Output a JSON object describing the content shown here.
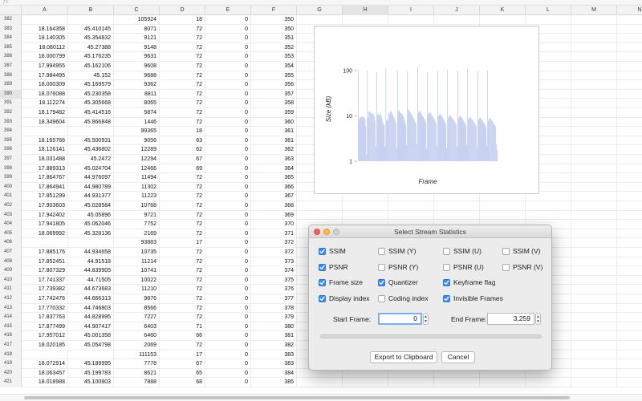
{
  "formula_bar": {
    "fx": "fx"
  },
  "columns": [
    "A",
    "B",
    "C",
    "D",
    "E",
    "F",
    "G",
    "H",
    "I",
    "J",
    "K",
    "L",
    "M",
    "N"
  ],
  "active_column": "H",
  "active_row": "390",
  "rows": [
    [
      "382",
      "",
      "",
      "105924",
      "18",
      "0",
      "350"
    ],
    [
      "383",
      "18.164358",
      "45.410145",
      "8071",
      "72",
      "0",
      "350"
    ],
    [
      "384",
      "18.140305",
      "45.354832",
      "9121",
      "72",
      "0",
      "351"
    ],
    [
      "385",
      "18.080112",
      "45.27388",
      "9148",
      "72",
      "0",
      "352"
    ],
    [
      "386",
      "18.000799",
      "45.176235",
      "9631",
      "72",
      "0",
      "353"
    ],
    [
      "387",
      "17.994955",
      "45.162106",
      "9608",
      "72",
      "0",
      "354"
    ],
    [
      "388",
      "17.984495",
      "45.152",
      "9688",
      "72",
      "0",
      "355"
    ],
    [
      "389",
      "18.000309",
      "45.169579",
      "9362",
      "72",
      "0",
      "356"
    ],
    [
      "390",
      "18.076088",
      "45.230358",
      "8811",
      "72",
      "0",
      "357"
    ],
    [
      "391",
      "18.112274",
      "45.305668",
      "8065",
      "72",
      "0",
      "358"
    ],
    [
      "392",
      "18.179482",
      "45.414516",
      "5874",
      "72",
      "0",
      "359"
    ],
    [
      "393",
      "18.349604",
      "45.866848",
      "1446",
      "72",
      "0",
      "360"
    ],
    [
      "394",
      "",
      "",
      "99365",
      "18",
      "0",
      "361"
    ],
    [
      "395",
      "18.165766",
      "45.500931",
      "9056",
      "63",
      "0",
      "361"
    ],
    [
      "396",
      "18.126141",
      "45.436802",
      "12289",
      "62",
      "0",
      "362"
    ],
    [
      "397",
      "18.031488",
      "45.2472",
      "12294",
      "67",
      "0",
      "363"
    ],
    [
      "398",
      "17.889313",
      "45.024704",
      "12466",
      "69",
      "0",
      "364"
    ],
    [
      "399",
      "17.864767",
      "44.976097",
      "11494",
      "72",
      "0",
      "365"
    ],
    [
      "400",
      "17.864941",
      "44.980789",
      "11302",
      "72",
      "0",
      "366"
    ],
    [
      "401",
      "17.851299",
      "44.931377",
      "11223",
      "72",
      "0",
      "367"
    ],
    [
      "402",
      "17.903603",
      "45.028584",
      "10768",
      "72",
      "0",
      "368"
    ],
    [
      "403",
      "17.942402",
      "45.05896",
      "9721",
      "72",
      "0",
      "369"
    ],
    [
      "404",
      "17.941805",
      "45.062046",
      "7752",
      "72",
      "0",
      "370"
    ],
    [
      "405",
      "18.069992",
      "45.328136",
      "2169",
      "72",
      "0",
      "371"
    ],
    [
      "406",
      "",
      "",
      "93883",
      "17",
      "0",
      "372"
    ],
    [
      "407",
      "17.885176",
      "44.934658",
      "10735",
      "72",
      "0",
      "372"
    ],
    [
      "408",
      "17.852451",
      "44.91518",
      "11214",
      "72",
      "0",
      "373"
    ],
    [
      "409",
      "17.807329",
      "44.839905",
      "10741",
      "72",
      "0",
      "374"
    ],
    [
      "410",
      "17.741337",
      "44.71505",
      "10022",
      "72",
      "0",
      "375"
    ],
    [
      "411",
      "17.739382",
      "44.673683",
      "11210",
      "72",
      "0",
      "376"
    ],
    [
      "412",
      "17.742476",
      "44.666313",
      "9876",
      "72",
      "0",
      "377"
    ],
    [
      "413",
      "17.770332",
      "44.746803",
      "8566",
      "72",
      "0",
      "378"
    ],
    [
      "414",
      "17.837763",
      "44.828995",
      "7227",
      "72",
      "0",
      "379"
    ],
    [
      "415",
      "17.877499",
      "44.907417",
      "6403",
      "71",
      "0",
      "380"
    ],
    [
      "416",
      "17.957012",
      "45.001358",
      "6460",
      "66",
      "0",
      "381"
    ],
    [
      "417",
      "18.020185",
      "45.054798",
      "2069",
      "72",
      "0",
      "382"
    ],
    [
      "418",
      "",
      "",
      "111153",
      "17",
      "0",
      "383"
    ],
    [
      "419",
      "18.072914",
      "45.189995",
      "7778",
      "67",
      "0",
      "383"
    ],
    [
      "420",
      "18.063457",
      "45.199783",
      "8621",
      "65",
      "0",
      "384"
    ],
    [
      "421",
      "18.018988",
      "45.100803",
      "7888",
      "68",
      "0",
      "385"
    ]
  ],
  "chart_data": {
    "type": "bar",
    "xlabel": "Frame",
    "ylabel": "Size (kB)",
    "yscale": "log",
    "ylim": [
      1,
      200
    ],
    "yticks": [
      "100",
      "10",
      "1"
    ],
    "bar_color": "#9fb0e6",
    "values": [
      105.9,
      8.1,
      9.1,
      9.1,
      9.6,
      9.6,
      9.7,
      9.4,
      8.8,
      8.1,
      5.9,
      1.4,
      99.4,
      9.1,
      12.3,
      12.3,
      12.5,
      11.5,
      11.3,
      11.2,
      10.8,
      9.7,
      7.8,
      2.2,
      93.9,
      10.7,
      11.2,
      10.7,
      10.0,
      11.2,
      9.9,
      8.6,
      7.2,
      6.4,
      6.5,
      2.1,
      111.2,
      7.8,
      8.6,
      7.9,
      12.0,
      11.0,
      13.0,
      12.5,
      11.8,
      10.5,
      9.8,
      9.0,
      8.0,
      6.8,
      2.0,
      101.0,
      12.8,
      13.5,
      12.0,
      11.5,
      11.7,
      10.9,
      10.2,
      9.5,
      8.3,
      7.4,
      6.2,
      2.3,
      95.5,
      14.2,
      13.1,
      12.6,
      11.9,
      11.1,
      10.4,
      9.7,
      8.9,
      8.1,
      7.3,
      6.6,
      2.4,
      120.0,
      12.1,
      11.8,
      12.5,
      12.9,
      11.6,
      10.3,
      9.9,
      9.2,
      8.7,
      7.9,
      7.0,
      1.9,
      93.0,
      10.8,
      11.4,
      12.2,
      11.7,
      10.9,
      10.1,
      9.6,
      8.8,
      8.2,
      7.5,
      6.9,
      2.2,
      98.0,
      9.9,
      10.5,
      11.3,
      10.7,
      10.0,
      9.4,
      8.9,
      8.4,
      7.7,
      7.1,
      6.4,
      2.0,
      104.0,
      9.1,
      9.8,
      10.4,
      10.0,
      9.5,
      9.0,
      8.6,
      8.0,
      7.6,
      7.0,
      6.5,
      2.1,
      99.0,
      8.8,
      9.5,
      10.1,
      9.7,
      9.2,
      8.7,
      8.2,
      7.8,
      7.2,
      6.8,
      6.1,
      2.3,
      108.0,
      8.4,
      9.0,
      9.6,
      9.2,
      8.7,
      8.3,
      7.9,
      7.4,
      6.9,
      6.4,
      5.9,
      2.0,
      96.0,
      8.2,
      8.9,
      9.3,
      8.8,
      8.4,
      7.9,
      7.5,
      7.0,
      6.6,
      6.1,
      5.6,
      2.2,
      101.0,
      7.9,
      8.5,
      9.0,
      8.6,
      8.1,
      7.7,
      7.2,
      6.8,
      6.3,
      5.9,
      2.4,
      1.8
    ]
  },
  "dialog": {
    "title": "Select Stream Statistics",
    "checkboxes": [
      {
        "label": "SSIM",
        "checked": true
      },
      {
        "label": "SSIM (Y)",
        "checked": false
      },
      {
        "label": "SSIM (U)",
        "checked": false
      },
      {
        "label": "SSIM (V)",
        "checked": false
      },
      {
        "label": "PSNR",
        "checked": true
      },
      {
        "label": "PSNR (Y)",
        "checked": false
      },
      {
        "label": "PSNR (U)",
        "checked": false
      },
      {
        "label": "PSNR (V)",
        "checked": false
      },
      {
        "label": "Frame size",
        "checked": true
      },
      {
        "label": "Quantizer",
        "checked": true
      },
      {
        "label": "Keyframe flag",
        "checked": true
      },
      {
        "label": "Display index",
        "checked": true
      },
      {
        "label": "Coding index",
        "checked": false
      },
      {
        "label": "Invisible Frames",
        "checked": true
      }
    ],
    "start_frame_label": "Start Frame:",
    "start_frame_value": "0",
    "end_frame_label": "End Frame:",
    "end_frame_value": "3,259",
    "export_button": "Export to Clipboard",
    "cancel_button": "Cancel",
    "progress": 0,
    "accent_color": "#3d8ef0"
  }
}
